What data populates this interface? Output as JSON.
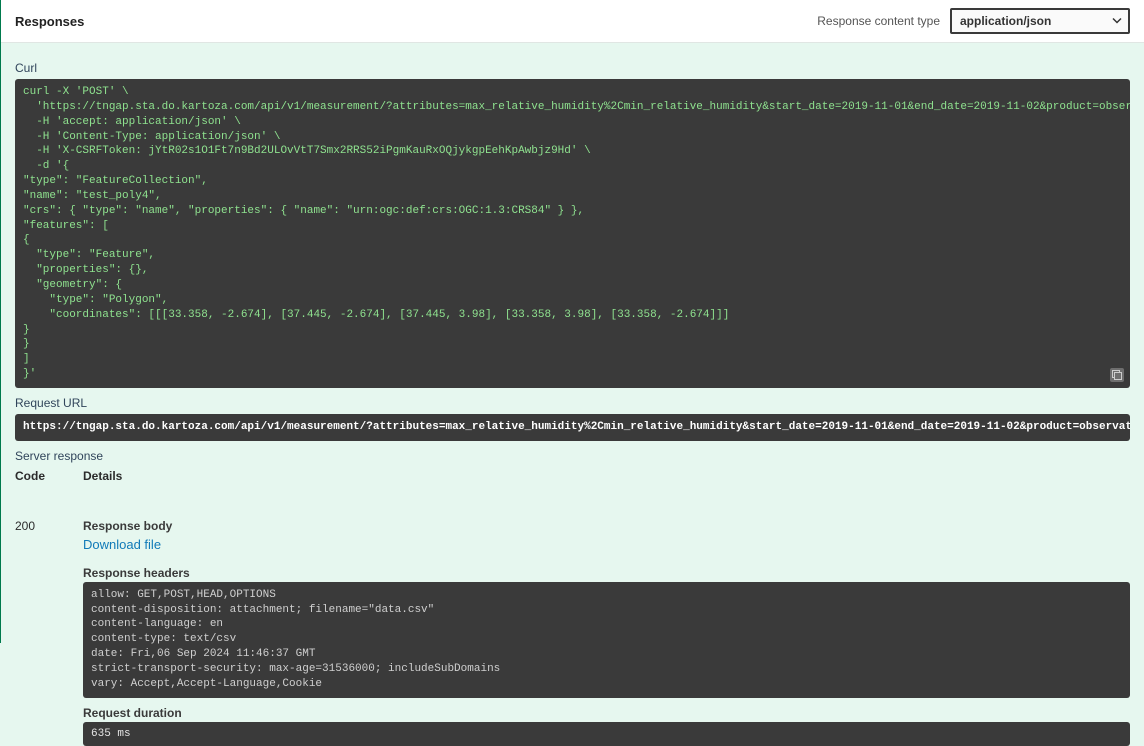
{
  "header": {
    "title": "Responses",
    "content_type_label": "Response content type",
    "content_type_value": "application/json"
  },
  "curl": {
    "label": "Curl",
    "body": "curl -X 'POST' \\\n  'https://tngap.sta.do.kartoza.com/api/v1/measurement/?attributes=max_relative_humidity%2Cmin_relative_humidity&start_date=2019-11-01&end_date=2019-11-02&product=observations&output_type=csv' \\\n  -H 'accept: application/json' \\\n  -H 'Content-Type: application/json' \\\n  -H 'X-CSRFToken: jYtR02s1O1Ft7n9Bd2ULOvVtT7Smx2RRS52iPgmKauRxOQjykgpEehKpAwbjz9Hd' \\\n  -d '{\n\"type\": \"FeatureCollection\",\n\"name\": \"test_poly4\",\n\"crs\": { \"type\": \"name\", \"properties\": { \"name\": \"urn:ogc:def:crs:OGC:1.3:CRS84\" } },\n\"features\": [\n{\n  \"type\": \"Feature\",\n  \"properties\": {},\n  \"geometry\": {\n    \"type\": \"Polygon\",\n    \"coordinates\": [[[33.358, -2.674], [37.445, -2.674], [37.445, 3.98], [33.358, 3.98], [33.358, -2.674]]]\n}\n}\n]\n}'"
  },
  "request_url": {
    "label": "Request URL",
    "value": "https://tngap.sta.do.kartoza.com/api/v1/measurement/?attributes=max_relative_humidity%2Cmin_relative_humidity&start_date=2019-11-01&end_date=2019-11-02&product=observations&output_type=csv"
  },
  "server_response": {
    "label": "Server response",
    "code_header": "Code",
    "details_header": "Details",
    "code": "200",
    "response_body_label": "Response body",
    "download_link": "Download file",
    "response_headers_label": "Response headers",
    "headers": " allow: GET,POST,HEAD,OPTIONS \n content-disposition: attachment; filename=\"data.csv\" \n content-language: en \n content-type: text/csv \n date: Fri,06 Sep 2024 11:46:37 GMT \n strict-transport-security: max-age=31536000; includeSubDomains \n vary: Accept,Accept-Language,Cookie ",
    "request_duration_label": "Request duration",
    "request_duration": " 635 ms"
  }
}
